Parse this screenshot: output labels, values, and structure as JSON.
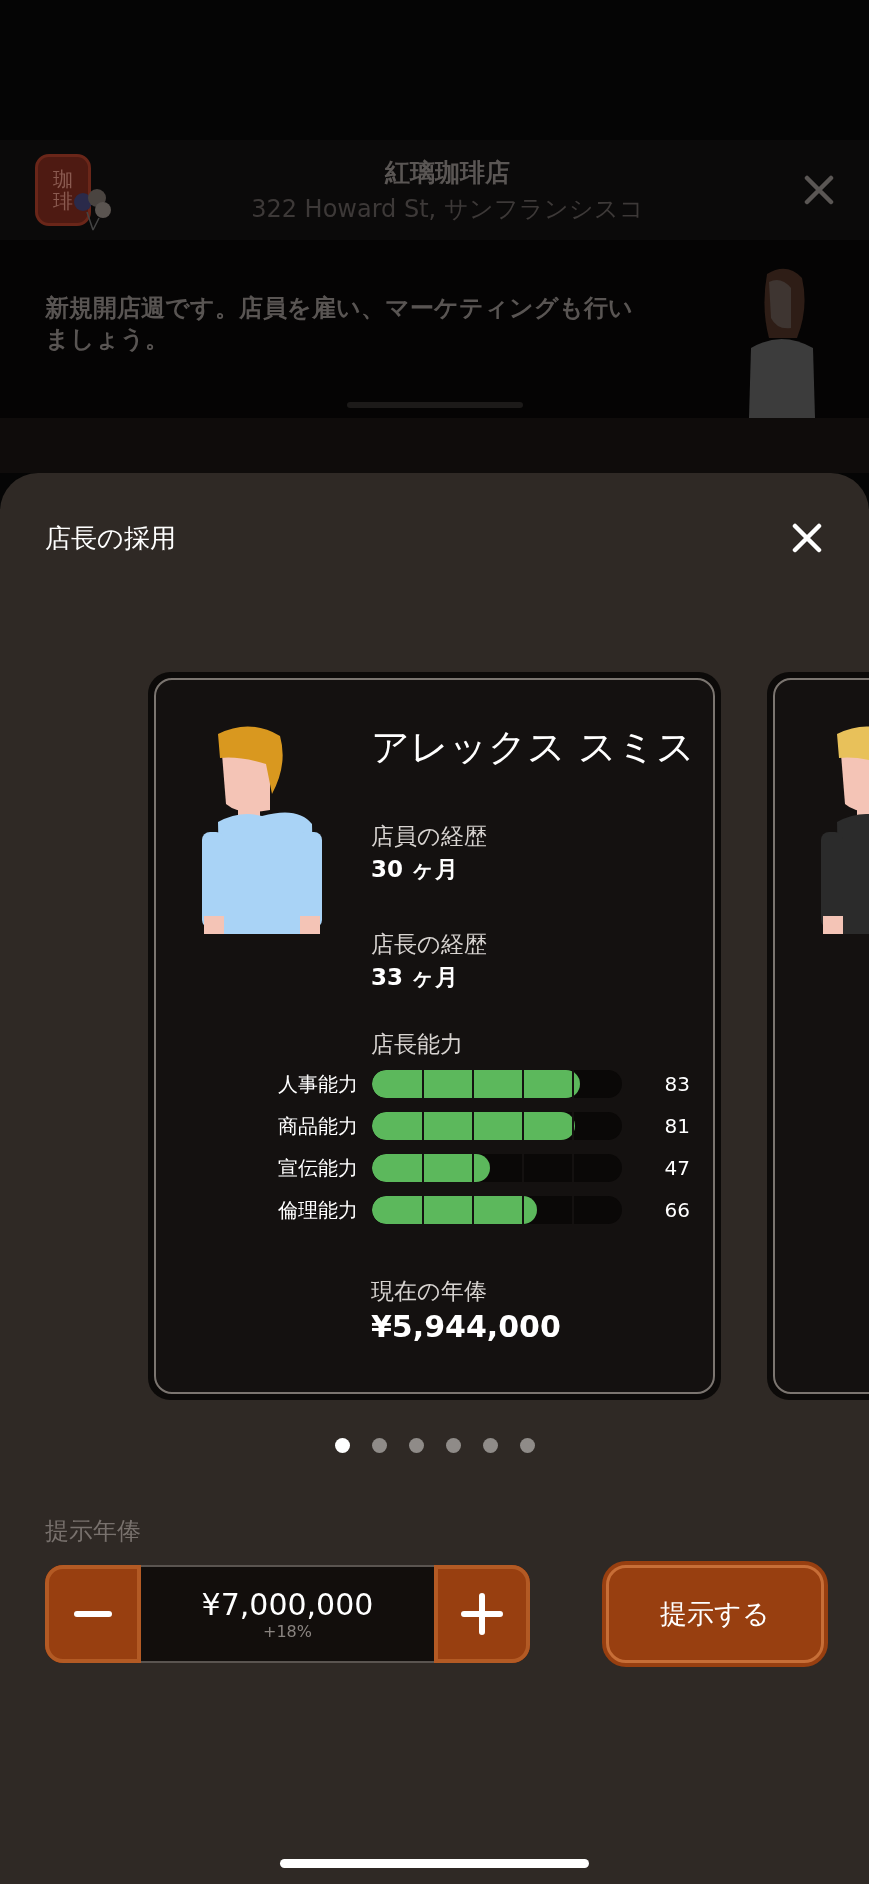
{
  "store": {
    "logo_text": "珈琲",
    "name": "紅璃珈琲店",
    "address": "322 Howard St, サンフランシスコ"
  },
  "notice": {
    "text": "新規開店週です。店員を雇い、マーケティングも行いましょう。"
  },
  "sheet": {
    "title": "店長の採用"
  },
  "candidate": {
    "name": "アレックス スミス",
    "staff_history_label": "店員の経歴",
    "staff_history": "30 ヶ月",
    "manager_history_label": "店長の経歴",
    "manager_history": "33 ヶ月",
    "skills_label": "店長能力",
    "skills": [
      {
        "label": "人事能力",
        "level": 0.83,
        "value": "83"
      },
      {
        "label": "商品能力",
        "level": 0.81,
        "value": "81"
      },
      {
        "label": "宣伝能力",
        "level": 0.47,
        "value": "47"
      },
      {
        "label": "倫理能力",
        "level": 0.66,
        "value": "66"
      }
    ],
    "salary_label": "現在の年俸",
    "salary": "¥5,944,000"
  },
  "pager": [
    {
      "selected": true
    },
    {
      "selected": false
    },
    {
      "selected": false
    },
    {
      "selected": false
    },
    {
      "selected": false
    },
    {
      "selected": false
    }
  ],
  "offer": {
    "label": "提示年俸",
    "amount": "¥7,000,000",
    "change": "+18%",
    "submit": "提示する"
  }
}
